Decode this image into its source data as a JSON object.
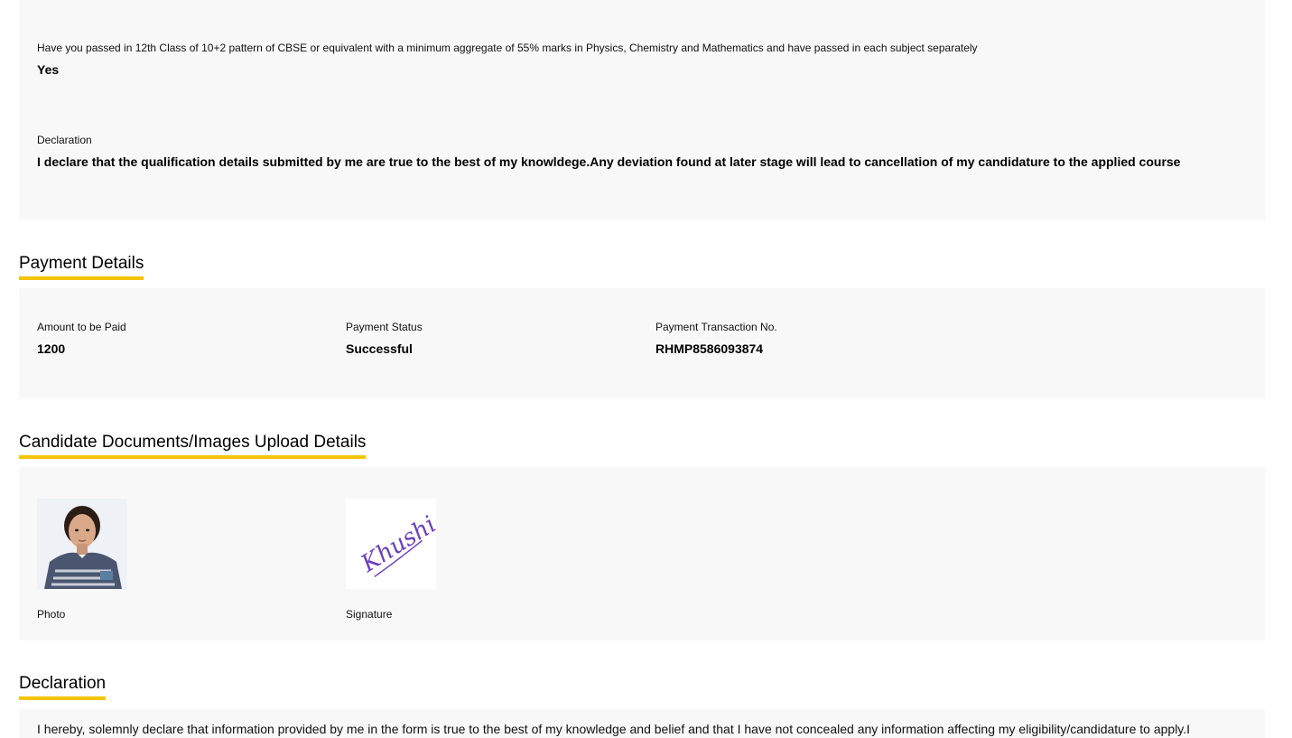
{
  "qualification": {
    "question_label": "Have you passed in 12th Class of 10+2 pattern of CBSE or equivalent with a minimum aggregate of 55% marks in Physics, Chemistry and Mathematics and have passed in each subject separately",
    "question_value": "Yes",
    "declaration_label": "Declaration",
    "declaration_value": "I declare that the qualification details submitted by me are true to the best of my knowldege.Any deviation found at later stage will lead to cancellation of my candidature to the applied course"
  },
  "payment": {
    "heading": "Payment Details",
    "amount_label": "Amount to be Paid",
    "amount_value": "1200",
    "status_label": "Payment Status",
    "status_value": "Successful",
    "transaction_label": "Payment Transaction No.",
    "transaction_value": "RHMP8586093874"
  },
  "documents": {
    "heading": "Candidate Documents/Images Upload Details",
    "photo_caption": "Photo",
    "signature_caption": "Signature",
    "signature_text": "Khushi"
  },
  "declaration": {
    "heading": "Declaration",
    "text": "I hereby, solemnly declare that information provided by me in the form is true to the best of my knowledge and belief and that I have not concealed any information affecting my eligibility/candidature to apply.I"
  },
  "colors": {
    "accent_underline": "#f5c400",
    "panel_background": "#f8f8f8"
  }
}
